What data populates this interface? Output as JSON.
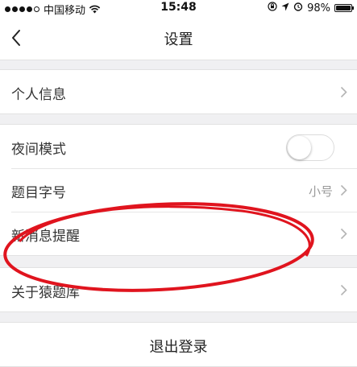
{
  "status_bar": {
    "carrier": "中国移动",
    "time": "15:48",
    "battery": "98%",
    "battery_level": 0.98,
    "signal_bars_filled": 4,
    "signal_bars_total": 5
  },
  "nav": {
    "title": "设置",
    "back_icon": "chevron-left-icon"
  },
  "groups": [
    {
      "items": [
        {
          "label": "个人信息",
          "accessory": "chevron"
        }
      ]
    },
    {
      "items": [
        {
          "label": "夜间模式",
          "accessory": "toggle",
          "toggle_on": false
        },
        {
          "label": "题目字号",
          "accessory": "value-chevron",
          "value": "小号"
        },
        {
          "label": "新消息提醒",
          "accessory": "chevron"
        }
      ]
    },
    {
      "items": [
        {
          "label": "关于猿题库",
          "accessory": "chevron"
        }
      ]
    }
  ],
  "logout": {
    "label": "退出登录"
  },
  "colors": {
    "background": "#f0f0f2",
    "cell": "#ffffff",
    "annotation": "#e0141e",
    "secondary_text": "#999999"
  }
}
